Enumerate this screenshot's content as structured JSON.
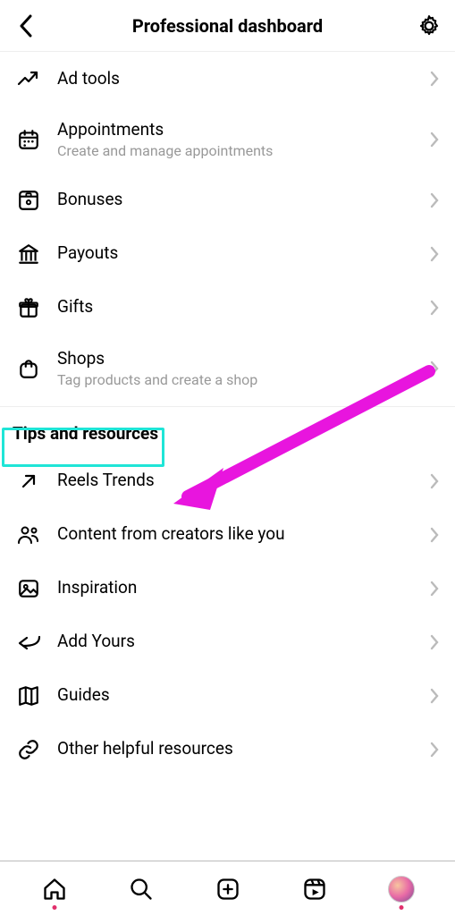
{
  "header": {
    "title": "Professional dashboard"
  },
  "section1": {
    "items": [
      {
        "icon": "trend-up-icon",
        "label": "Ad tools",
        "sub": ""
      },
      {
        "icon": "calendar-icon",
        "label": "Appointments",
        "sub": "Create and manage appointments"
      },
      {
        "icon": "trophy-icon",
        "label": "Bonuses",
        "sub": ""
      },
      {
        "icon": "bank-icon",
        "label": "Payouts",
        "sub": ""
      },
      {
        "icon": "gift-icon",
        "label": "Gifts",
        "sub": ""
      },
      {
        "icon": "shop-bag-icon",
        "label": "Shops",
        "sub": "Tag products and create a shop"
      }
    ]
  },
  "section2": {
    "title": "Tips and resources",
    "items": [
      {
        "icon": "arrow-up-right-icon",
        "label": "Reels Trends",
        "sub": ""
      },
      {
        "icon": "people-icon",
        "label": "Content from creators like you",
        "sub": ""
      },
      {
        "icon": "image-icon",
        "label": "Inspiration",
        "sub": ""
      },
      {
        "icon": "reply-arrow-icon",
        "label": "Add Yours",
        "sub": ""
      },
      {
        "icon": "map-icon",
        "label": "Guides",
        "sub": ""
      },
      {
        "icon": "link-icon",
        "label": "Other helpful resources",
        "sub": ""
      }
    ]
  },
  "annotations": {
    "highlight_target": "section-header-tips",
    "arrow_target": "list-item-reels-trends",
    "arrow_color": "#E815DE"
  }
}
